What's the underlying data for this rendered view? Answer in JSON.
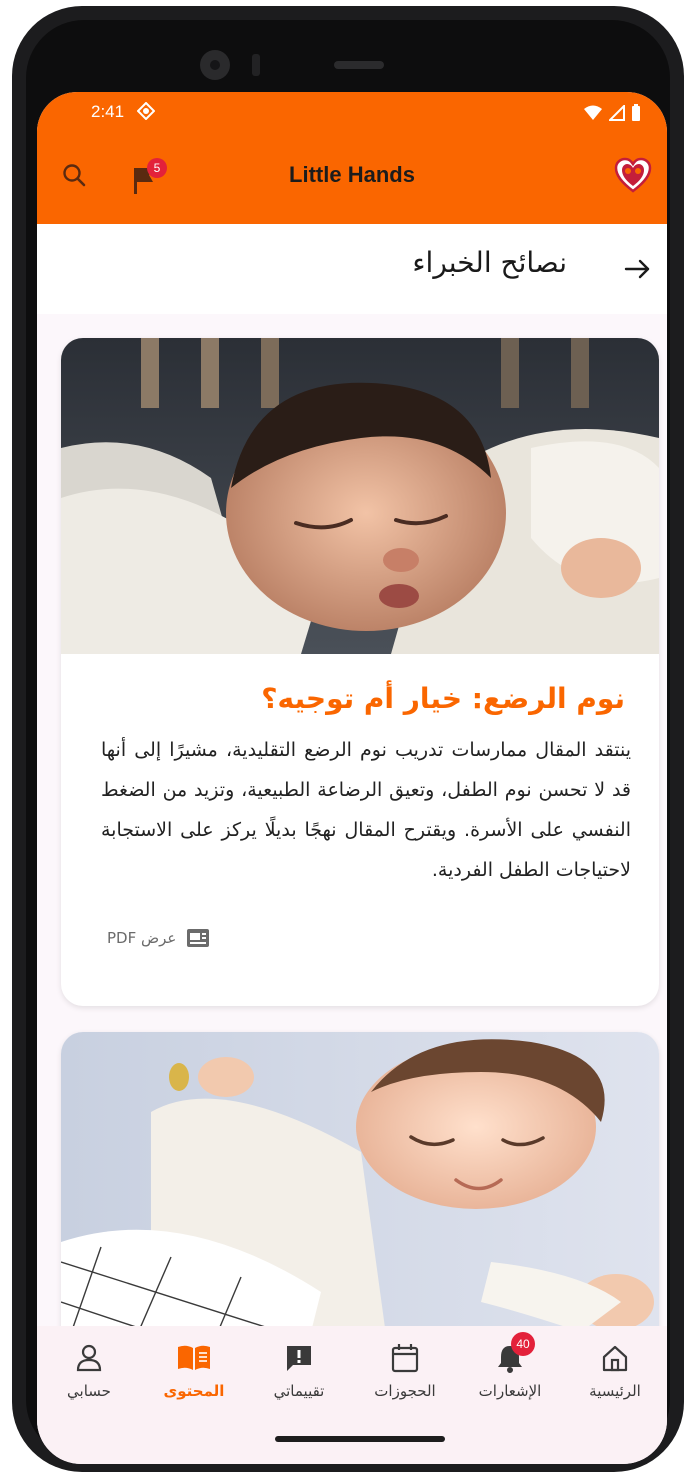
{
  "status_bar": {
    "time": "2:41"
  },
  "header": {
    "title": "Little Hands",
    "notifications_badge": "5"
  },
  "page": {
    "title": "نصائح الخبراء"
  },
  "articles": [
    {
      "title": "نوم الرضع: خيار أم توجيه؟",
      "body": "ينتقد المقال ممارسات تدريب نوم الرضع التقليدية، مشيرًا إلى أنها قد لا تحسن نوم الطفل، وتعيق الرضاعة الطبيعية، وتزيد من الضغط النفسي على الأسرة. ويقترح المقال نهجًا بديلًا يركز على الاستجابة لاحتياجات الطفل الفردية.",
      "pdf_label": "عرض PDF"
    }
  ],
  "bottom_nav": {
    "items": [
      {
        "label": "حسابي",
        "icon": "person-icon"
      },
      {
        "label": "المحتوى",
        "icon": "book-icon",
        "active": true
      },
      {
        "label": "تقييماتي",
        "icon": "feedback-icon"
      },
      {
        "label": "الحجوزات",
        "icon": "calendar-icon"
      },
      {
        "label": "الإشعارات",
        "icon": "bell-icon",
        "badge": "40"
      },
      {
        "label": "الرئيسية",
        "icon": "home-icon"
      }
    ]
  },
  "colors": {
    "brand": "#fa6600",
    "badge": "#e3213a",
    "background": "#fcf7fb"
  }
}
